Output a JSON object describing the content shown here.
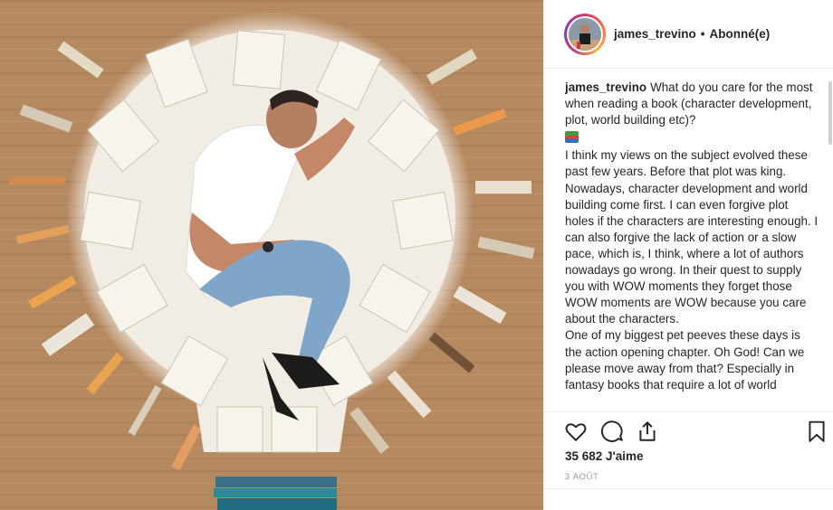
{
  "post": {
    "username": "james_trevino",
    "separator": "•",
    "follow_status": "Abonné(e)"
  },
  "caption": {
    "username": "james_trevino",
    "question": "What do you care for the most when reading a book (character development, plot, world building etc)?",
    "emoji_icon": "books-emoji-icon",
    "paragraph_1": "I think my views on the subject evolved these past few years. Before that plot was king. Nowadays, character development and world building come first. I can even forgive plot holes if the characters are interesting enough. I can also forgive the lack of action or a slow pace, which is, I think, where a lot of authors nowadays go wrong. In their quest to supply you with WOW moments they forget those WOW moments are WOW because you care about the characters.",
    "paragraph_2": "One of my biggest pet peeves these days is the action opening chapter. Oh God! Can we please move away from that? Especially in fantasy books that require a lot of world"
  },
  "actions": {
    "like_icon": "heart-icon",
    "comment_icon": "comment-icon",
    "share_icon": "share-icon",
    "save_icon": "bookmark-icon"
  },
  "likes_text": "35 682 J'aime",
  "date_text": "3 AOÛT",
  "colors": {
    "text": "#262626",
    "border": "#efefef",
    "muted": "#999999",
    "wood": "#b98d63"
  }
}
